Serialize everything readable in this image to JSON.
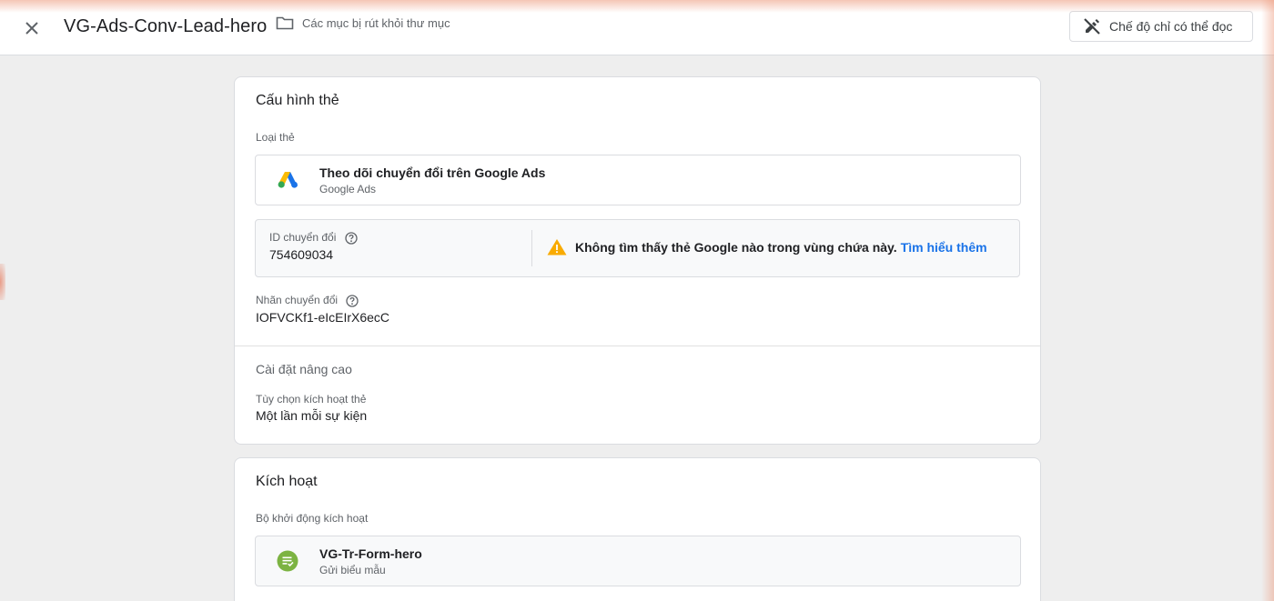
{
  "header": {
    "tag_name": "VG-Ads-Conv-Lead-hero",
    "folder_label": "Các mục bị rút khỏi thư mục",
    "readonly_label": "Chế độ chỉ có thể đọc"
  },
  "tag_config": {
    "title": "Cấu hình thẻ",
    "tag_type_label": "Loại thẻ",
    "tag_type_name": "Theo dõi chuyển đổi trên Google Ads",
    "tag_type_sub": "Google Ads",
    "conversion_id_label": "ID chuyển đổi",
    "conversion_id_value": "754609034",
    "warning_text": "Không tìm thấy thẻ Google nào trong vùng chứa này.",
    "warning_link": "Tìm hiểu thêm",
    "conversion_label_label": "Nhãn chuyển đổi",
    "conversion_label_value": "IOFVCKf1-eIcEIrX6ecC",
    "advanced_title": "Cài đặt nâng cao",
    "firing_option_label": "Tùy chọn kích hoạt thẻ",
    "firing_option_value": "Một lần mỗi sự kiện"
  },
  "triggering": {
    "title": "Kích hoạt",
    "triggers_label": "Bộ khởi động kích hoạt",
    "trigger_name": "VG-Tr-Form-hero",
    "trigger_type": "Gửi biểu mẫu"
  },
  "icons": {
    "close": "close-icon",
    "folder": "folder-icon",
    "readonly": "edit-off-icon",
    "google_ads": "google-ads-icon",
    "help": "help-icon",
    "warning": "warning-icon",
    "form_trigger": "form-submission-icon"
  },
  "colors": {
    "accent_link": "#1a73e8",
    "warning": "#f9ab00",
    "trigger_green": "#7cb342"
  }
}
